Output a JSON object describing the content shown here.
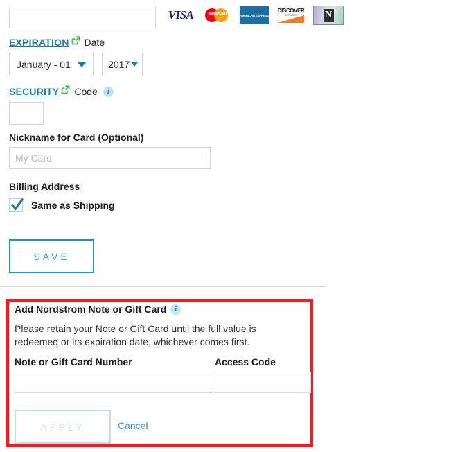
{
  "payment_form": {
    "card_number": {
      "value": "",
      "placeholder": ""
    },
    "accepted_cards": [
      {
        "name": "visa-logo",
        "label": "VISA"
      },
      {
        "name": "mastercard-logo",
        "label": "MasterCard"
      },
      {
        "name": "amex-logo",
        "label": "AMERICAN EXPRESS"
      },
      {
        "name": "discover-logo",
        "label": "DISCOVER",
        "sub": "NETWORK"
      },
      {
        "name": "nordstrom-card-logo",
        "label": "N"
      }
    ],
    "expiration": {
      "link_text": "EXPIRATION",
      "suffix_text": "Date",
      "month_value": "January - 01",
      "year_value": "2017"
    },
    "security": {
      "link_text": "SECURITY",
      "suffix_text": "Code",
      "info_glyph": "i",
      "value": ""
    },
    "nickname": {
      "label": "Nickname for Card (Optional)",
      "value": "",
      "placeholder": "My Card"
    },
    "billing": {
      "label": "Billing Address",
      "checkbox_label": "Same as Shipping",
      "checked": true
    },
    "save_label": "SAVE"
  },
  "gift_card": {
    "heading": "Add Nordstrom Note or Gift Card",
    "info_glyph": "i",
    "description": "Please retain your Note or Gift Card until the full value is redeemed or its expiration date, whichever comes first.",
    "number_label": "Note or Gift Card Number",
    "number_value": "",
    "access_code_label": "Access Code",
    "access_code_value": "",
    "apply_label": "APPLY",
    "cancel_label": "Cancel"
  },
  "colors": {
    "accent_teal": "#1f93bb",
    "link_teal": "#1f7fa0",
    "highlight_red": "#ee1c25",
    "info_badge": "#bfe4f2",
    "green_icon": "#3dbb3d"
  }
}
